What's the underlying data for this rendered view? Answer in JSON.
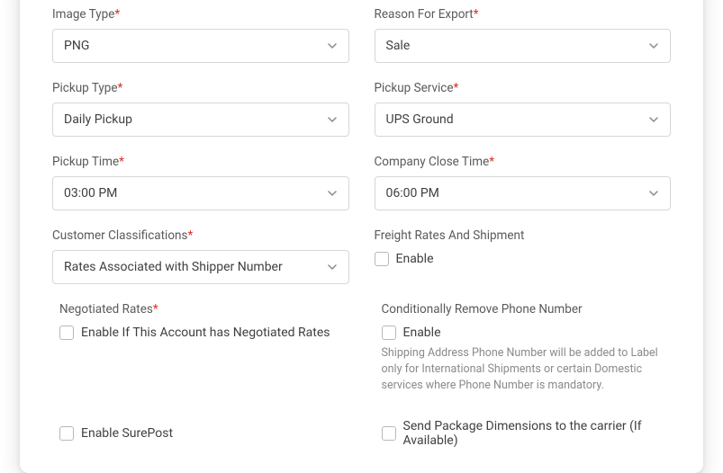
{
  "imageType": {
    "label": "Image Type",
    "value": "PNG"
  },
  "reasonForExport": {
    "label": "Reason For Export",
    "value": "Sale"
  },
  "pickupType": {
    "label": "Pickup Type",
    "value": "Daily Pickup"
  },
  "pickupService": {
    "label": "Pickup Service",
    "value": "UPS Ground"
  },
  "pickupTime": {
    "label": "Pickup Time",
    "value": "03:00 PM"
  },
  "companyCloseTime": {
    "label": "Company Close Time",
    "value": "06:00 PM"
  },
  "customerClassifications": {
    "label": "Customer Classifications",
    "value": "Rates Associated with Shipper Number"
  },
  "freightRates": {
    "label": "Freight Rates And Shipment",
    "enableLabel": "Enable"
  },
  "negotiatedRates": {
    "label": "Negotiated Rates",
    "enableLabel": "Enable If This Account has Negotiated Rates"
  },
  "conditionallyRemovePhone": {
    "label": "Conditionally Remove Phone Number",
    "enableLabel": "Enable",
    "help": "Shipping Address Phone Number will be added to Label only for International Shipments or certain Domestic services where Phone Number is mandatory."
  },
  "enableSurepost": {
    "label": "Enable SurePost"
  },
  "sendPackageDimensions": {
    "label": "Send Package Dimensions to the carrier (If Available)"
  },
  "asterisk": "*"
}
